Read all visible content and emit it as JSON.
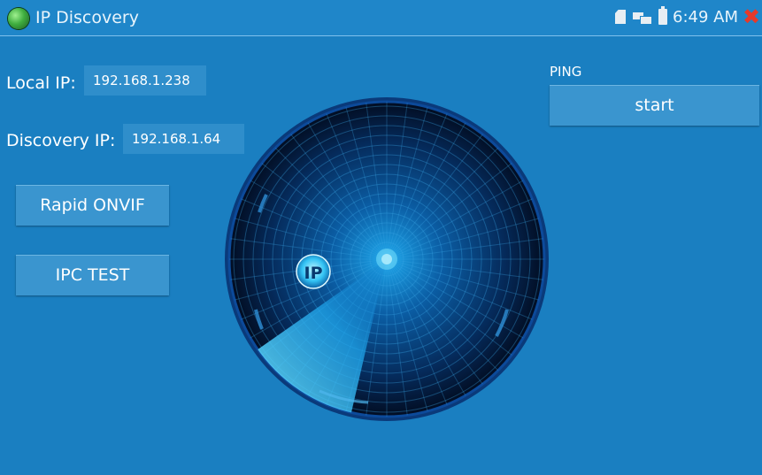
{
  "titlebar": {
    "title": "IP Discovery",
    "app_icon": "app-globe-icon",
    "status": {
      "sd_icon": "sd-card-icon",
      "network_icon": "network-icon",
      "battery_icon": "battery-icon",
      "time": "6:49 AM",
      "close_icon": "close-icon"
    }
  },
  "fields": {
    "local_ip_label": "Local IP:",
    "local_ip_value": "192.168.1.238",
    "discovery_ip_label": "Discovery IP:",
    "discovery_ip_value": "192.168.1.64"
  },
  "buttons": {
    "rapid_onvif": "Rapid ONVIF",
    "ipc_test": "IPC TEST",
    "ping_label": "PING",
    "ping_start": "start"
  },
  "radar": {
    "badge": "IP"
  },
  "colors": {
    "background": "#1a7fc1",
    "button": "#3a95cf",
    "input": "#2f8ecb",
    "close": "#e53a2a",
    "radar_dark": "#041634",
    "radar_glow": "#2ec6ff"
  }
}
